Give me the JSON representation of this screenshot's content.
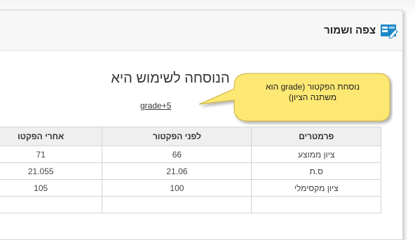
{
  "panel": {
    "title": "צפה ושמור"
  },
  "formula": {
    "heading": "הנוסחה לשימוש היא",
    "expression": "grade+5"
  },
  "callout": {
    "line1": "נוסחת הפקטור (grade הוא",
    "line2": "משתנה הציון)"
  },
  "table": {
    "headers": [
      "פרמטרים",
      "לפני הפקטור",
      "אחרי הפקטו"
    ],
    "rows": [
      [
        "ציון ממוצע",
        "66",
        "71"
      ],
      [
        "ס.ת",
        "21.06",
        "21.055"
      ],
      [
        "ציון מקסימלי",
        "100",
        "105"
      ],
      [
        "",
        "",
        ""
      ]
    ]
  },
  "colors": {
    "accent": "#1e88c7",
    "callout_fill": "#fde873",
    "header_bg": "#efefef"
  },
  "icons": {
    "title_icon": "edit-table-icon"
  }
}
